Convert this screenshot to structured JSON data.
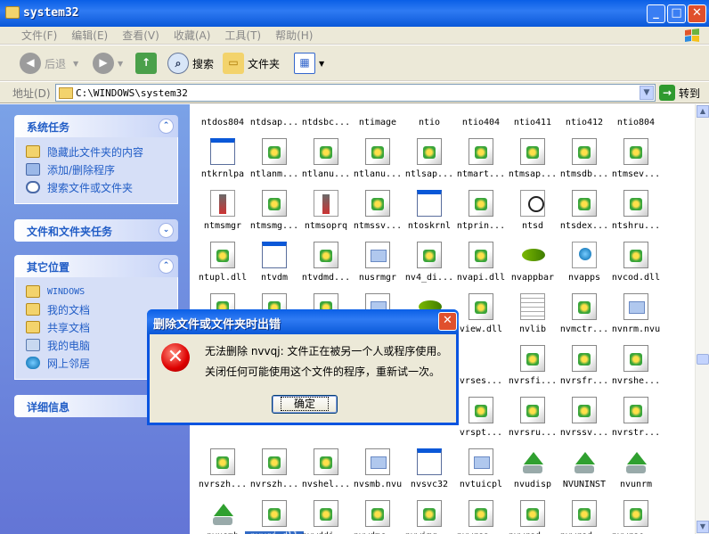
{
  "window": {
    "title": "system32"
  },
  "menu": [
    "文件(F)",
    "编辑(E)",
    "查看(V)",
    "收藏(A)",
    "工具(T)",
    "帮助(H)"
  ],
  "toolbar": {
    "back": "后退",
    "search": "搜索",
    "folders": "文件夹"
  },
  "address": {
    "label": "地址(D)",
    "value": "C:\\WINDOWS\\system32",
    "go": "转到"
  },
  "left": {
    "system_tasks": {
      "title": "系统任务",
      "items": [
        "隐藏此文件夹的内容",
        "添加/删除程序",
        "搜索文件或文件夹"
      ]
    },
    "file_tasks": {
      "title": "文件和文件夹任务"
    },
    "other_places": {
      "title": "其它位置",
      "items": [
        "WINDOWS",
        "我的文档",
        "共享文档",
        "我的电脑",
        "网上邻居"
      ]
    },
    "details": {
      "title": "详细信息"
    }
  },
  "files": [
    {
      "label": "ntdos804",
      "icon": "none"
    },
    {
      "label": "ntdsap...",
      "icon": "none"
    },
    {
      "label": "ntdsbc...",
      "icon": "none"
    },
    {
      "label": "ntimage",
      "icon": "none"
    },
    {
      "label": "ntio",
      "icon": "none"
    },
    {
      "label": "ntio404",
      "icon": "none"
    },
    {
      "label": "ntio411",
      "icon": "none"
    },
    {
      "label": "ntio412",
      "icon": "none"
    },
    {
      "label": "ntio804",
      "icon": "none"
    },
    {
      "label": "ntkrnlpa",
      "icon": "exe"
    },
    {
      "label": "ntlanm...",
      "icon": "dll"
    },
    {
      "label": "ntlanu...",
      "icon": "dll"
    },
    {
      "label": "ntlanu...",
      "icon": "dll"
    },
    {
      "label": "ntlsap...",
      "icon": "dll"
    },
    {
      "label": "ntmart...",
      "icon": "dll"
    },
    {
      "label": "ntmsap...",
      "icon": "dll"
    },
    {
      "label": "ntmsdb...",
      "icon": "dll"
    },
    {
      "label": "ntmsev...",
      "icon": "dll"
    },
    {
      "label": "ntmsmgr",
      "icon": "setup"
    },
    {
      "label": "ntmsmg...",
      "icon": "dll"
    },
    {
      "label": "ntmsoprq",
      "icon": "setup"
    },
    {
      "label": "ntmssv...",
      "icon": "dll"
    },
    {
      "label": "ntoskrnl",
      "icon": "exe"
    },
    {
      "label": "ntprin...",
      "icon": "dll"
    },
    {
      "label": "ntsd",
      "icon": "sys"
    },
    {
      "label": "ntsdex...",
      "icon": "dll"
    },
    {
      "label": "ntshru...",
      "icon": "dll"
    },
    {
      "label": "ntupl.dll",
      "icon": "dll"
    },
    {
      "label": "ntvdm",
      "icon": "exe"
    },
    {
      "label": "ntvdmd...",
      "icon": "dll"
    },
    {
      "label": "nusrmgr",
      "icon": "nvu"
    },
    {
      "label": "nv4_di...",
      "icon": "dll"
    },
    {
      "label": "nvapi.dll",
      "icon": "dll"
    },
    {
      "label": "nvappbar",
      "icon": "nv"
    },
    {
      "label": "nvapps",
      "icon": "earth"
    },
    {
      "label": "nvcod.dll",
      "icon": "dll"
    },
    {
      "label": "",
      "icon": "dll"
    },
    {
      "label": "",
      "icon": "dll"
    },
    {
      "label": "",
      "icon": "dll"
    },
    {
      "label": "",
      "icon": "nvu"
    },
    {
      "label": "",
      "icon": "nv"
    },
    {
      "label": "view.dll",
      "icon": "dll"
    },
    {
      "label": "nvlib",
      "icon": "txt"
    },
    {
      "label": "nvmctr...",
      "icon": "dll"
    },
    {
      "label": "nvnrm.nvu",
      "icon": "nvu"
    },
    {
      "label": "",
      "icon": "none"
    },
    {
      "label": "",
      "icon": "none"
    },
    {
      "label": "",
      "icon": "none"
    },
    {
      "label": "",
      "icon": "none"
    },
    {
      "label": "",
      "icon": "none"
    },
    {
      "label": "vrses...",
      "icon": "none"
    },
    {
      "label": "nvrsfi...",
      "icon": "dll"
    },
    {
      "label": "nvrsfr...",
      "icon": "dll"
    },
    {
      "label": "nvrshe...",
      "icon": "dll"
    },
    {
      "label": "",
      "icon": "none"
    },
    {
      "label": "",
      "icon": "none"
    },
    {
      "label": "",
      "icon": "none"
    },
    {
      "label": "",
      "icon": "none"
    },
    {
      "label": "",
      "icon": "none"
    },
    {
      "label": "vrspt...",
      "icon": "dll"
    },
    {
      "label": "nvrsru...",
      "icon": "dll"
    },
    {
      "label": "nvrssv...",
      "icon": "dll"
    },
    {
      "label": "nvrstr...",
      "icon": "dll"
    },
    {
      "label": "nvrszh...",
      "icon": "dll"
    },
    {
      "label": "nvrszh...",
      "icon": "dll"
    },
    {
      "label": "nvshel...",
      "icon": "dll"
    },
    {
      "label": "nvsmb.nvu",
      "icon": "nvu"
    },
    {
      "label": "nvsvc32",
      "icon": "exe"
    },
    {
      "label": "nvtuicpl",
      "icon": "nvu"
    },
    {
      "label": "nvudisp",
      "icon": "inst"
    },
    {
      "label": "NVUNINST",
      "icon": "inst"
    },
    {
      "label": "nvunrm",
      "icon": "inst"
    },
    {
      "label": "nvusmb",
      "icon": "inst"
    },
    {
      "label": "nvvqj.dll",
      "icon": "dll"
    },
    {
      "label": "nvwddi...",
      "icon": "dll"
    },
    {
      "label": "nvwdmc...",
      "icon": "dll"
    },
    {
      "label": "nvwimg...",
      "icon": "dll"
    },
    {
      "label": "nvwrsa...",
      "icon": "dll"
    },
    {
      "label": "nvwrsd...",
      "icon": "dll"
    },
    {
      "label": "nvwrsd...",
      "icon": "dll"
    },
    {
      "label": "nvwrse...",
      "icon": "dll"
    }
  ],
  "dialog": {
    "title": "删除文件或文件夹时出错",
    "line1": "无法删除 nvvqj: 文件正在被另一个人或程序使用。",
    "line2": "关闭任何可能使用这个文件的程序，重新试一次。",
    "ok": "确定",
    "icon": "error-icon"
  }
}
